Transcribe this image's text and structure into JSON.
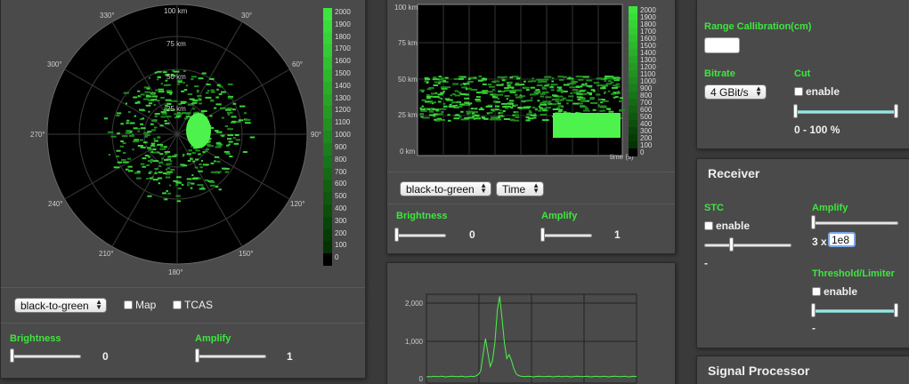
{
  "colors": {
    "accent_green": "#3ee63e",
    "panel_bg": "#4a4a4a",
    "plot_bg": "#000000",
    "bright_green": "#4df24d"
  },
  "ppi": {
    "range_labels": [
      "100 km",
      "75 km",
      "50 km",
      "25 km"
    ],
    "bearing_labels": [
      "330°",
      "30°",
      "300°",
      "60°",
      "270°",
      "90°",
      "240°",
      "120°",
      "210°",
      "150°",
      "180°"
    ],
    "colorbar_ticks": [
      "2000",
      "1900",
      "1800",
      "1700",
      "1600",
      "1500",
      "1400",
      "1300",
      "1200",
      "1100",
      "1000",
      "900",
      "800",
      "700",
      "600",
      "500",
      "400",
      "300",
      "200",
      "100",
      "0"
    ],
    "colormap_select": "black-to-green",
    "map_label": "Map",
    "tcas_label": "TCAS",
    "brightness_label": "Brightness",
    "brightness_value": "0",
    "brightness_level": 0,
    "amplify_label": "Amplify",
    "amplify_value": "1",
    "amplify_level": 0
  },
  "waterfall": {
    "y_labels": [
      "100 km",
      "75 km",
      "50 km",
      "25 km",
      "0 km"
    ],
    "x_label": "time (s)",
    "colorbar_ticks": [
      "2000",
      "1900",
      "1800",
      "1700",
      "1600",
      "1500",
      "1400",
      "1300",
      "1200",
      "1100",
      "1000",
      "900",
      "800",
      "700",
      "600",
      "500",
      "400",
      "300",
      "200",
      "100",
      "0"
    ],
    "colormap_select": "black-to-green",
    "axis_select": "Time",
    "brightness_label": "Brightness",
    "brightness_value": "0",
    "brightness_level": 0,
    "amplify_label": "Amplify",
    "amplify_value": "1",
    "amplify_level": 0
  },
  "chart_data": {
    "type": "line",
    "title": "",
    "xlabel": "",
    "ylabel": "",
    "y_ticks": [
      "2,000",
      "1,000",
      "0"
    ],
    "ylim": [
      0,
      2100
    ],
    "series": [
      {
        "values": [
          40,
          55,
          45,
          60,
          50,
          48,
          62,
          55,
          45,
          50,
          58,
          60,
          52,
          48,
          55,
          63,
          50,
          45,
          55,
          60,
          50,
          70,
          100,
          200,
          600,
          1000,
          650,
          300,
          450,
          900,
          1700,
          2050,
          1500,
          900,
          500,
          600,
          450,
          250,
          120,
          80,
          60,
          55,
          50,
          62,
          55,
          45,
          50,
          58,
          60,
          52,
          48,
          55,
          63,
          50,
          45,
          55,
          60,
          50,
          48,
          62,
          55,
          45,
          50,
          58,
          60,
          52,
          48,
          55,
          63,
          50,
          45,
          55,
          60,
          50,
          48,
          62,
          55,
          45,
          50,
          58,
          60,
          52,
          48,
          55,
          63,
          50,
          45,
          55,
          60,
          50
        ]
      }
    ]
  },
  "settings": {
    "range_calibration_label": "Range Callibration(cm)",
    "bitrate_label": "Bitrate",
    "bitrate_value": "4 GBit/s",
    "cut_label": "Cut",
    "cut_enable": "enable",
    "cut_range": "0 - 100 %"
  },
  "receiver": {
    "title": "Receiver",
    "stc_label": "STC",
    "stc_enable": "enable",
    "stc_value": "-",
    "amplify_label": "Amplify",
    "amplify_prefix": "3 x",
    "amplify_input": "1e8",
    "threshold_label": "Threshold/Limiter",
    "threshold_enable": "enable",
    "threshold_value": "-"
  },
  "signal_processor": {
    "title": "Signal Processor"
  }
}
